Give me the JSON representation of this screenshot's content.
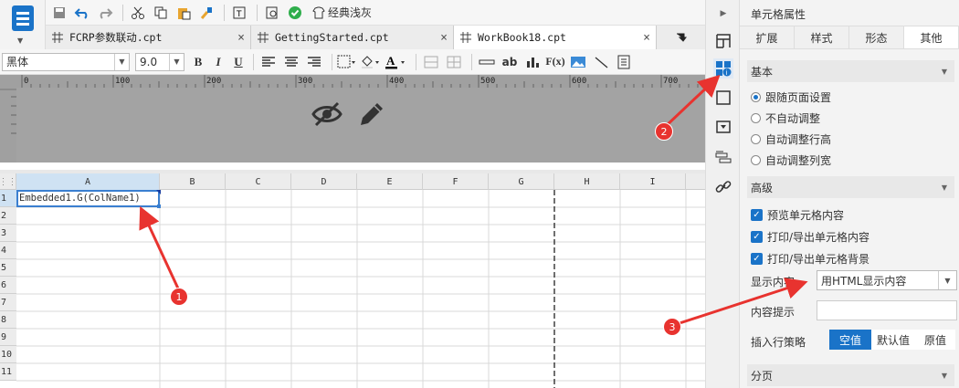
{
  "toolbar": {
    "classic_gray": "经典浅灰"
  },
  "tabs": [
    {
      "label": "FCRP参数联动.cpt",
      "close": "×"
    },
    {
      "label": "GettingStarted.cpt",
      "close": "×"
    },
    {
      "label": "WorkBook18.cpt",
      "close": "×"
    }
  ],
  "format": {
    "font": "黑体",
    "size": "9.0",
    "bold": "B",
    "italic": "I",
    "underline": "U",
    "text_btn": "ab",
    "formula_btn": "F(x)"
  },
  "ruler": {
    "ticks": [
      "0",
      "100",
      "200",
      "300",
      "400",
      "500",
      "600",
      "700"
    ]
  },
  "grid": {
    "columns": [
      "A",
      "B",
      "C",
      "D",
      "E",
      "F",
      "G",
      "H",
      "I"
    ],
    "rows": [
      "1",
      "2",
      "3",
      "4",
      "5",
      "6",
      "7",
      "8",
      "9",
      "10",
      "11"
    ],
    "a1_value": "Embedded1.G(ColName1)"
  },
  "annotations": {
    "n1": "1",
    "n2": "2",
    "n3": "3"
  },
  "panel": {
    "title": "单元格属性",
    "tabs": [
      "扩展",
      "样式",
      "形态",
      "其他"
    ],
    "active_tab": "其他",
    "basic_section": "基本",
    "radio_options": [
      "跟随页面设置",
      "不自动调整",
      "自动调整行高",
      "自动调整列宽"
    ],
    "advanced_section": "高级",
    "checkboxes": [
      "预览单元格内容",
      "打印/导出单元格内容",
      "打印/导出单元格背景"
    ],
    "display_label": "显示内容",
    "display_value": "用HTML显示内容",
    "tooltip_label": "内容提示",
    "tooltip_value": "",
    "insert_label": "插入行策略",
    "insert_options": [
      "空值",
      "默认值",
      "原值"
    ],
    "paging_section": "分页"
  },
  "colors": {
    "accent": "#1a73c8",
    "arrow": "#e8332f"
  }
}
